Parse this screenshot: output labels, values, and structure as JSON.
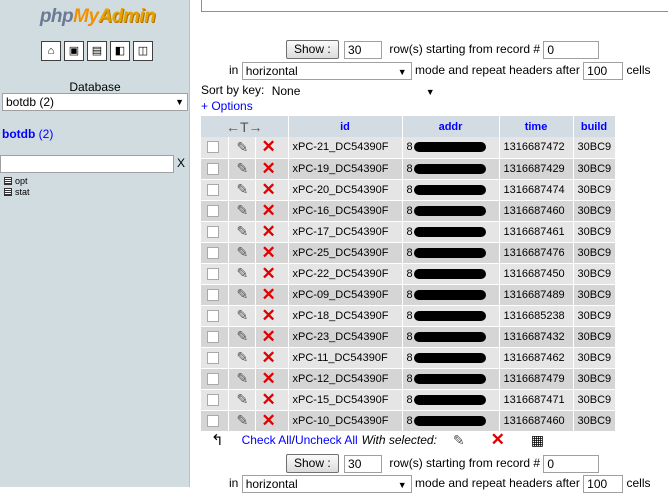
{
  "logo": {
    "part1": "php",
    "part2": "My",
    "part3": "Admin"
  },
  "nav_icons": [
    {
      "name": "home-icon",
      "glyph": "⌂"
    },
    {
      "name": "query-window-icon",
      "glyph": "▣"
    },
    {
      "name": "sql-icon",
      "glyph": "▤"
    },
    {
      "name": "docs-icon",
      "glyph": "◧"
    },
    {
      "name": "reload-icon",
      "glyph": "◫"
    }
  ],
  "left": {
    "database_label": "Database",
    "database_selected": "botdb (2)",
    "db_link_name": "botdb",
    "db_link_count": "(2)",
    "filter_clear": "X",
    "tables": [
      "opt",
      "stat"
    ]
  },
  "navigation": {
    "show_label": "Show :",
    "rows_value": "30",
    "rows_text": "row(s) starting from record #",
    "start_record": "0",
    "in_label": "in",
    "mode_value": "horizontal",
    "mode_text": "mode and repeat headers after",
    "repeat_value": "100",
    "cells_text": "cells"
  },
  "sort": {
    "label": "Sort by key:",
    "value": "None"
  },
  "options_link": "+ Options",
  "table": {
    "columns": [
      "id",
      "addr",
      "time",
      "build"
    ],
    "addr_prefix": "8",
    "rows": [
      {
        "id": "xPC-21_DC54390F",
        "time": "1316687472",
        "build": "30BC9"
      },
      {
        "id": "xPC-19_DC54390F",
        "time": "1316687429",
        "build": "30BC9"
      },
      {
        "id": "xPC-20_DC54390F",
        "time": "1316687474",
        "build": "30BC9"
      },
      {
        "id": "xPC-16_DC54390F",
        "time": "1316687460",
        "build": "30BC9"
      },
      {
        "id": "xPC-17_DC54390F",
        "time": "1316687461",
        "build": "30BC9"
      },
      {
        "id": "xPC-25_DC54390F",
        "time": "1316687476",
        "build": "30BC9"
      },
      {
        "id": "xPC-22_DC54390F",
        "time": "1316687450",
        "build": "30BC9"
      },
      {
        "id": "xPC-09_DC54390F",
        "time": "1316687489",
        "build": "30BC9"
      },
      {
        "id": "xPC-18_DC54390F",
        "time": "1316685238",
        "build": "30BC9"
      },
      {
        "id": "xPC-23_DC54390F",
        "time": "1316687432",
        "build": "30BC9"
      },
      {
        "id": "xPC-11_DC54390F",
        "time": "1316687462",
        "build": "30BC9"
      },
      {
        "id": "xPC-12_DC54390F",
        "time": "1316687479",
        "build": "30BC9"
      },
      {
        "id": "xPC-15_DC54390F",
        "time": "1316687471",
        "build": "30BC9"
      },
      {
        "id": "xPC-10_DC54390F",
        "time": "1316687460",
        "build": "30BC9"
      }
    ]
  },
  "bulk": {
    "check_all": "Check All",
    "separator": " / ",
    "uncheck_all": "Uncheck All",
    "with_selected": "With selected:"
  }
}
